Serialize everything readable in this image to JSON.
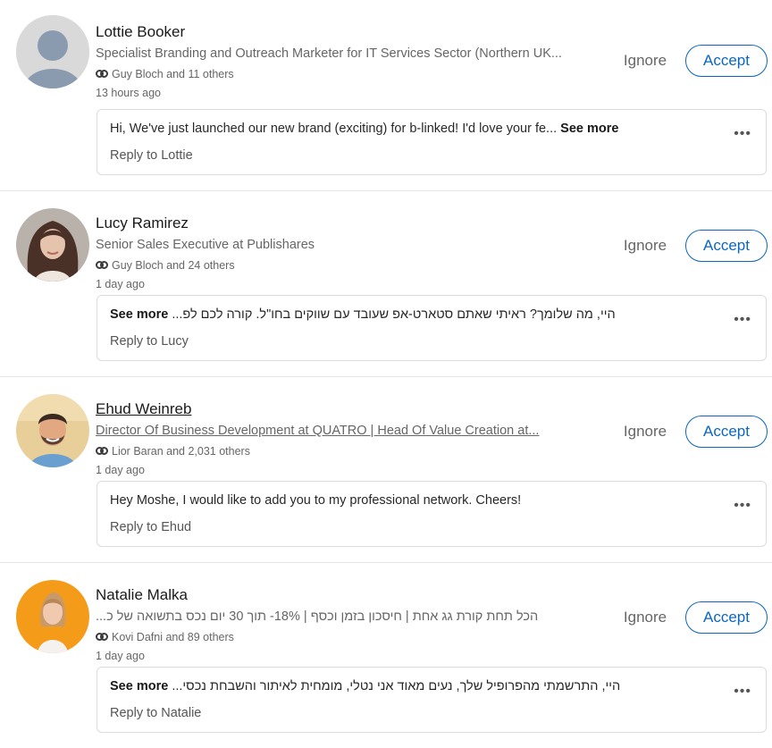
{
  "invitations": [
    {
      "name": "Lottie Booker",
      "headline": "Specialist Branding and Outreach Marketer for IT Services Sector (Northern UK...",
      "mutual": "Guy Bloch and 11 others",
      "time": "13 hours ago",
      "ignore_label": "Ignore",
      "accept_label": "Accept",
      "message": "Hi, We've just launched our new brand (exciting) for b-linked! I'd love your fe...",
      "see_more": "See more",
      "reply": "Reply to Lottie",
      "more_icon": "more-horizontal-icon"
    },
    {
      "name": "Lucy Ramirez",
      "headline": "Senior Sales Executive at Publishares",
      "mutual": "Guy Bloch and 24 others",
      "time": "1 day ago",
      "ignore_label": "Ignore",
      "accept_label": "Accept",
      "message": "היי, מה שלומך? ראיתי שאתם סטארט-אפ שעובד עם שווקים בחו\"ל. קורה לכם לפ...",
      "see_more": "See more",
      "reply": "Reply to Lucy",
      "more_icon": "more-horizontal-icon"
    },
    {
      "name": "Ehud Weinreb",
      "headline": "Director Of Business Development at QUATRO | Head Of Value Creation at...",
      "mutual": "Lior Baran and 2,031 others",
      "time": "1 day ago",
      "ignore_label": "Ignore",
      "accept_label": "Accept",
      "message": "Hey Moshe, I would like to add you to my professional network. Cheers!",
      "see_more": "",
      "reply": "Reply to Ehud",
      "more_icon": "more-horizontal-icon"
    },
    {
      "name": "Natalie Malka",
      "headline": "הכל תחת קורת גג אחת | חיסכון בזמן וכסף | 18%- תוך 30 יום נכס בתשואה של כ...",
      "mutual": "Kovi Dafni and 89 others",
      "time": "1 day ago",
      "ignore_label": "Ignore",
      "accept_label": "Accept",
      "message": "היי, התרשמתי מהפרופיל שלך, נעים מאוד אני נטלי, מומחית לאיתור והשבחת נכסי...",
      "see_more": "See more",
      "reply": "Reply to Natalie",
      "more_icon": "more-horizontal-icon"
    }
  ],
  "colors": {
    "accent": "#0a66c2",
    "muted": "#666666"
  }
}
